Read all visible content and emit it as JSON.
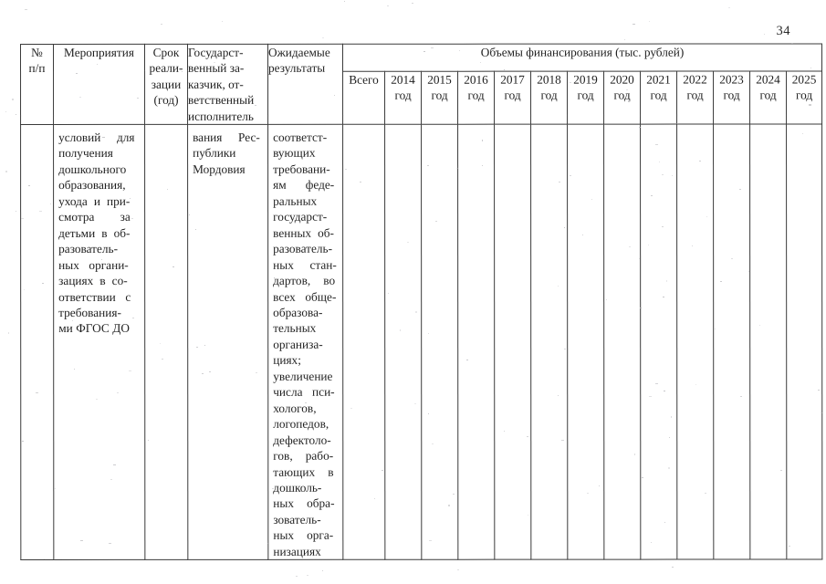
{
  "page": {
    "number": "34"
  },
  "table": {
    "headers": {
      "col_number": {
        "line1": "№",
        "line2": "п/п"
      },
      "col_measures": "Мероприятия",
      "col_term": {
        "line1": "Срок",
        "line2": "реали-",
        "line3": "зации",
        "line4": "(год)"
      },
      "col_customer": {
        "line1": "Государст-",
        "line2": "венный     за-",
        "line3": "казчик,     от-",
        "line4": "ветственный",
        "line5": "исполнитель"
      },
      "col_results": {
        "line1": "Ожидаемые",
        "line2": "результаты"
      },
      "col_funding_group": "Объемы финансирования (тыс. рублей)",
      "col_total": "Всего",
      "years": [
        {
          "num": "2014",
          "word": "год"
        },
        {
          "num": "2015",
          "word": "год"
        },
        {
          "num": "2016",
          "word": "год"
        },
        {
          "num": "2017",
          "word": "год"
        },
        {
          "num": "2018",
          "word": "год"
        },
        {
          "num": "2019",
          "word": "год"
        },
        {
          "num": "2020",
          "word": "год"
        },
        {
          "num": "2021",
          "word": "год"
        },
        {
          "num": "2022",
          "word": "год"
        },
        {
          "num": "2023",
          "word": "год"
        },
        {
          "num": "2024",
          "word": "год"
        },
        {
          "num": "2025",
          "word": "год"
        }
      ]
    },
    "row": {
      "number": "",
      "measures_lines": [
        "условий     для",
        "получения",
        "дошкольного",
        "образования,",
        "ухода  и  при-",
        "смотра        за",
        "детьми  в  об-",
        "разователь-",
        "ных   органи-",
        "зациях  в  со-",
        "ответствии   с",
        "требования-",
        "ми ФГОС ДО"
      ],
      "term": "",
      "customer_lines": [
        "вания     Рес-",
        "публики",
        "Мордовия"
      ],
      "results_lines": [
        "соответст-",
        "вующих",
        "требовани-",
        "ям      феде-",
        "ральных",
        "государст-",
        "венных  об-",
        "разователь-",
        "ных     стан-",
        "дартов,    во",
        "всех   обще-",
        "образова-",
        "тельных",
        "организа-",
        "циях;",
        "увеличение",
        "числа   пси-",
        "хологов,",
        "логопедов,",
        "дефектоло-",
        "гов,    рабо-",
        "тающих    в",
        "дошколь-",
        "ных    обра-",
        "зователь-",
        "ных    орга-",
        "низациях"
      ],
      "total": "",
      "year_values": [
        "",
        "",
        "",
        "",
        "",
        "",
        "",
        "",
        "",
        "",
        "",
        ""
      ]
    }
  }
}
